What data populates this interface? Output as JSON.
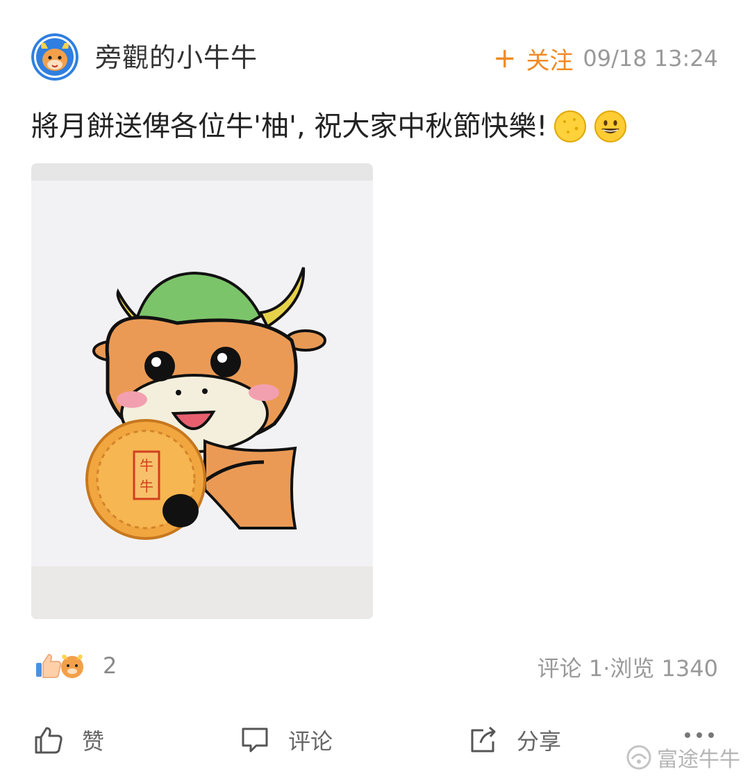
{
  "post": {
    "author_name": "旁觀的小牛牛",
    "follow_label": "关注",
    "follow_icon": "+",
    "timestamp": "09/18 13:24",
    "text": "將月餅送俾各位牛'柚', 祝大家中秋節快樂!",
    "emojis": [
      "mooncake-emoji",
      "grinning-face-emoji"
    ],
    "image": "hand-drawn orange cartoon bull holding a mooncake"
  },
  "stats": {
    "reaction_count": "2",
    "comments_views": "评论 1·浏览 1340"
  },
  "actions": {
    "like_label": "赞",
    "comment_label": "评论",
    "share_label": "分享"
  },
  "watermark": {
    "text": "富途牛牛"
  },
  "colors": {
    "accent": "#f08a24",
    "avatar_bg": "#2f7fe0",
    "muted_text": "#999999"
  }
}
